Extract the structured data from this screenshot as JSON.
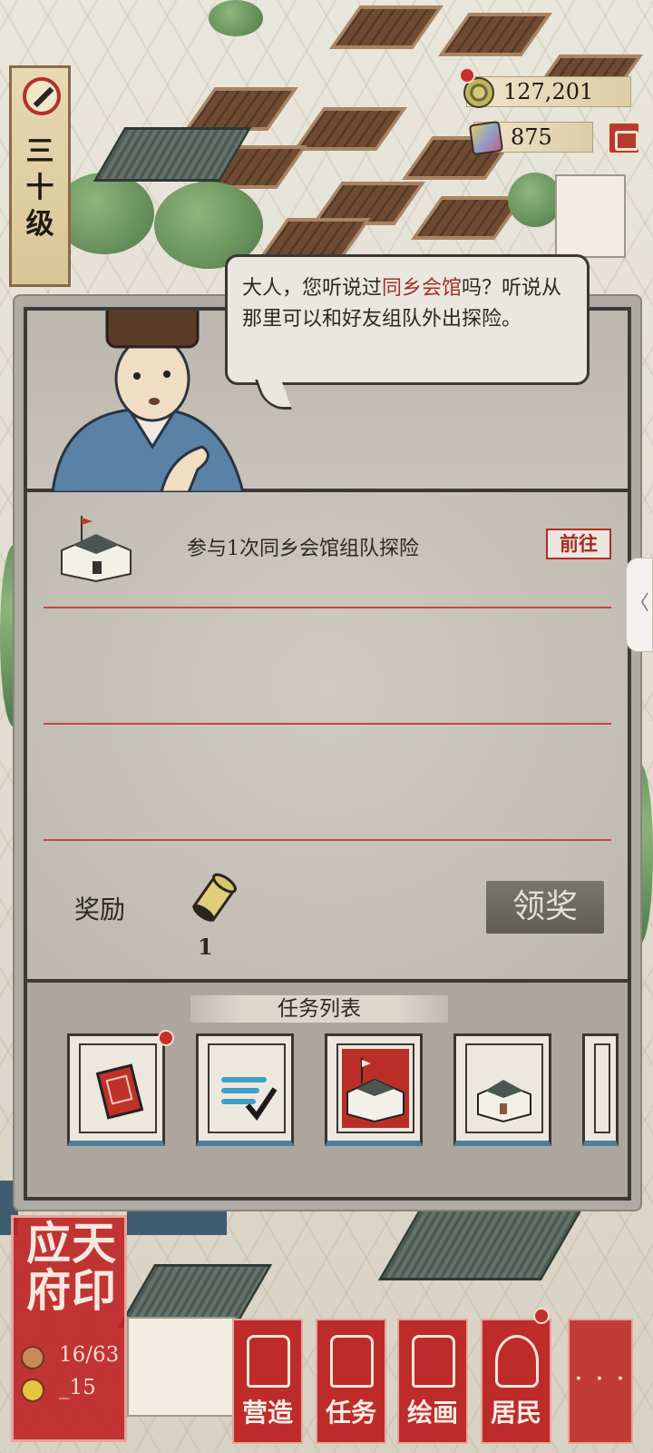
{
  "level": {
    "label": "三十级"
  },
  "currency": [
    {
      "icon": "copper-coin-icon",
      "value": "127,201"
    },
    {
      "icon": "jade-gem-icon",
      "value": "875"
    }
  ],
  "dialog": {
    "text_before": "大人，您听说过",
    "highlight": "同乡会馆",
    "text_after": "吗？听说从那里可以和好友组队外出探险。"
  },
  "task": {
    "description": "参与1次同乡会馆组队探险",
    "goto_label": "前往"
  },
  "reward": {
    "label": "奖励",
    "item_icon": "scroll-icon",
    "count": "1",
    "claim_label": "领奖"
  },
  "task_list": {
    "title": "任务列表",
    "books": [
      {
        "icon": "red-seal-book-icon",
        "badge": true
      },
      {
        "icon": "checklist-icon",
        "badge": false
      },
      {
        "icon": "guild-hall-icon",
        "badge": false,
        "active": true
      },
      {
        "icon": "building-icon",
        "badge": false
      }
    ]
  },
  "city_seal": {
    "chars": "应天府印",
    "residents": "16/63",
    "gold": "_15"
  },
  "bottom_nav": [
    {
      "label": "营造",
      "icon": "build-icon"
    },
    {
      "label": "任务",
      "icon": "task-icon"
    },
    {
      "label": "绘画",
      "icon": "painting-icon"
    },
    {
      "label": "居民",
      "icon": "resident-icon"
    }
  ],
  "more_label": "· · ·",
  "side_tab_glyph": "〈",
  "colors": {
    "accent_red": "#bd2c2a",
    "panel": "#c9c4bc",
    "ink": "#2c2824"
  }
}
